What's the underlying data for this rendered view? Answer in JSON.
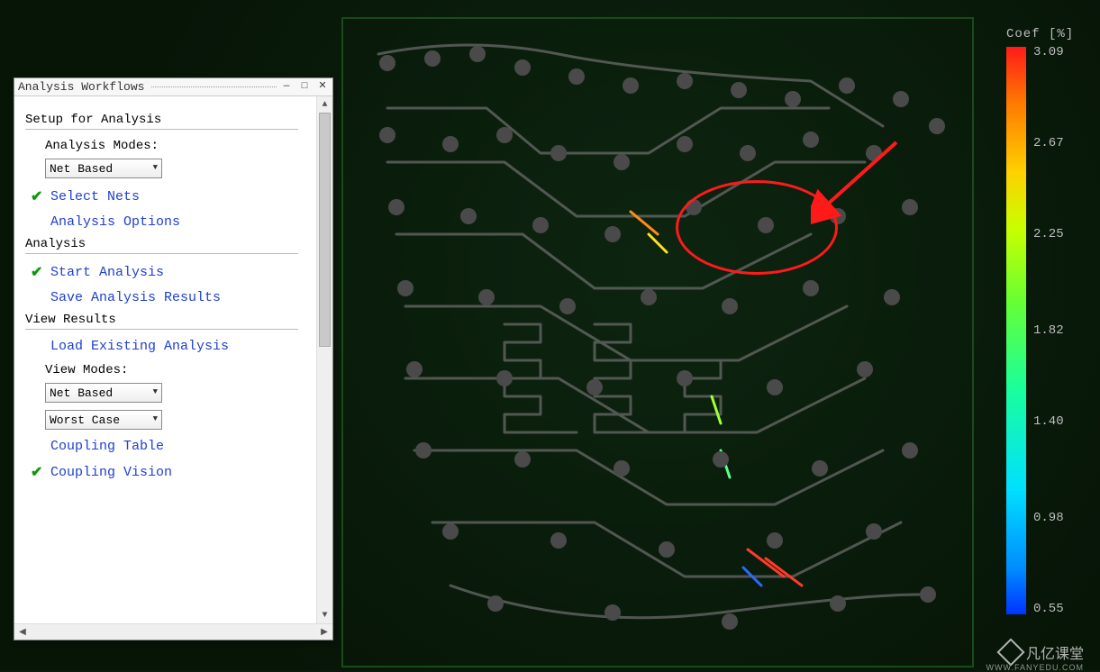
{
  "panel": {
    "title": "Analysis Workflows",
    "sections": {
      "setup": {
        "header": "Setup for Analysis",
        "modes_label": "Analysis Modes:",
        "modes_value": "Net Based",
        "select_nets": "Select Nets",
        "analysis_options": "Analysis Options"
      },
      "analysis": {
        "header": "Analysis",
        "start": "Start Analysis",
        "save": "Save Analysis Results"
      },
      "view": {
        "header": "View Results",
        "load": "Load Existing Analysis",
        "modes_label": "View Modes:",
        "modes_value": "Net Based",
        "case_value": "Worst Case",
        "coupling_table": "Coupling Table",
        "coupling_vision": "Coupling Vision"
      }
    }
  },
  "legend": {
    "title": "Coef [%]",
    "ticks": [
      "3.09",
      "2.67",
      "2.25",
      "1.82",
      "1.40",
      "0.98",
      "0.55"
    ]
  },
  "watermark": {
    "text": "凡亿课堂",
    "sub": "WWW.FANYEDU.COM"
  }
}
